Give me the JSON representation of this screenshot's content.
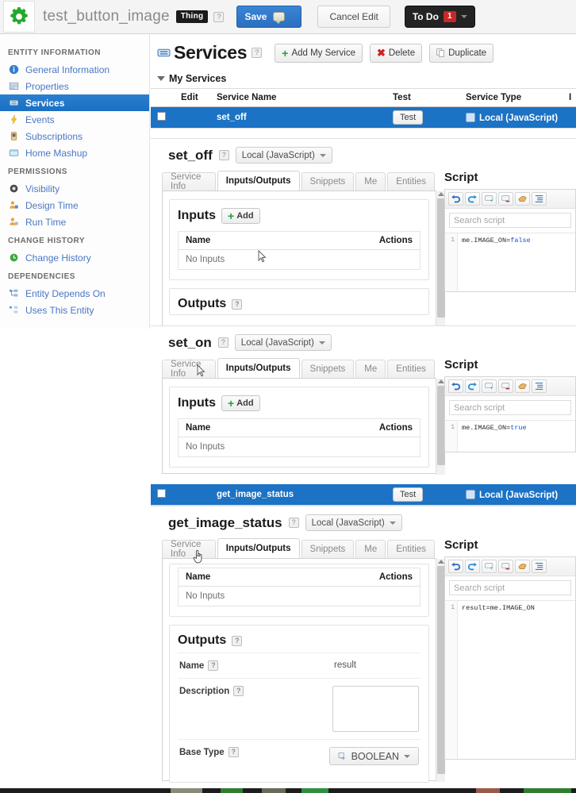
{
  "topbar": {
    "gear_icon": "gear-icon",
    "entity_name": "test_button_image",
    "entity_type_badge": "Thing",
    "help_glyph": "?",
    "save_label": "Save",
    "cancel_label": "Cancel Edit",
    "todo_label": "To Do",
    "todo_count": "1"
  },
  "sidebar": {
    "groups": [
      {
        "title": "ENTITY INFORMATION",
        "items": [
          {
            "label": "General Information",
            "icon": "info-icon",
            "active": false
          },
          {
            "label": "Properties",
            "icon": "properties-icon",
            "active": false
          },
          {
            "label": "Services",
            "icon": "services-icon",
            "active": true
          },
          {
            "label": "Events",
            "icon": "lightning-icon",
            "active": false
          },
          {
            "label": "Subscriptions",
            "icon": "subscriptions-icon",
            "active": false
          },
          {
            "label": "Home Mashup",
            "icon": "mashup-icon",
            "active": false
          }
        ]
      },
      {
        "title": "PERMISSIONS",
        "items": [
          {
            "label": "Visibility",
            "icon": "eye-icon",
            "active": false
          },
          {
            "label": "Design Time",
            "icon": "user-lock-icon",
            "active": false
          },
          {
            "label": "Run Time",
            "icon": "user-lock-icon",
            "active": false
          }
        ]
      },
      {
        "title": "CHANGE HISTORY",
        "items": [
          {
            "label": "Change History",
            "icon": "history-icon",
            "active": false
          }
        ]
      },
      {
        "title": "DEPENDENCIES",
        "items": [
          {
            "label": "Entity Depends On",
            "icon": "depends-on-icon",
            "active": false
          },
          {
            "label": "Uses This Entity",
            "icon": "used-by-icon",
            "active": false
          }
        ]
      }
    ]
  },
  "main": {
    "page_title": "Services",
    "page_title_icon": "services-icon",
    "help_glyph": "?",
    "toolbar": [
      {
        "label": "Add My Service",
        "icon": "plus-icon"
      },
      {
        "label": "Delete",
        "icon": "x-icon"
      },
      {
        "label": "Duplicate",
        "icon": "duplicate-icon"
      }
    ],
    "section_label": "My Services",
    "table": {
      "columns": [
        "",
        "Edit",
        "Service Name",
        "Test",
        "Service Type",
        "I"
      ],
      "rows": [
        {
          "name": "set_off",
          "test_label": "Test",
          "service_type": "Local (JavaScript)",
          "selected": true
        },
        {
          "name": "get_image_status",
          "test_label": "Test",
          "service_type": "Local (JavaScript)",
          "selected": true
        }
      ]
    }
  },
  "panels": [
    {
      "name": "set_off",
      "help_glyph": "?",
      "language": "Local (JavaScript)",
      "tabs": [
        {
          "label": "Service Info",
          "active": false
        },
        {
          "label": "Inputs/Outputs",
          "active": true
        },
        {
          "label": "Snippets",
          "active": false
        },
        {
          "label": "Me",
          "active": false
        },
        {
          "label": "Entities",
          "active": false
        }
      ],
      "inputs": {
        "title": "Inputs",
        "add_label": "Add",
        "col_name": "Name",
        "col_actions": "Actions",
        "empty_text": "No Inputs"
      },
      "outputs": {
        "title": "Outputs",
        "help_glyph": "?"
      },
      "script": {
        "title": "Script",
        "search_placeholder": "Search script",
        "line_number": "1",
        "code_prefix": "me.IMAGE_ON=",
        "code_keyword": "false"
      }
    },
    {
      "name": "set_on",
      "help_glyph": "?",
      "language": "Local (JavaScript)",
      "tabs": [
        {
          "label": "Service Info",
          "active": false
        },
        {
          "label": "Inputs/Outputs",
          "active": true
        },
        {
          "label": "Snippets",
          "active": false
        },
        {
          "label": "Me",
          "active": false
        },
        {
          "label": "Entities",
          "active": false
        }
      ],
      "inputs": {
        "title": "Inputs",
        "add_label": "Add",
        "col_name": "Name",
        "col_actions": "Actions",
        "empty_text": "No Inputs"
      },
      "script": {
        "title": "Script",
        "search_placeholder": "Search script",
        "line_number": "1",
        "code_prefix": "me.IMAGE_ON=",
        "code_keyword": "true"
      }
    },
    {
      "name": "get_image_status",
      "help_glyph": "?",
      "language": "Local (JavaScript)",
      "tabs": [
        {
          "label": "Service Info",
          "active": false
        },
        {
          "label": "Inputs/Outputs",
          "active": true
        },
        {
          "label": "Snippets",
          "active": false
        },
        {
          "label": "Me",
          "active": false
        },
        {
          "label": "Entities",
          "active": false
        }
      ],
      "inputs": {
        "col_name": "Name",
        "col_actions": "Actions",
        "empty_text": "No Inputs"
      },
      "outputs": {
        "title": "Outputs",
        "help_glyph": "?",
        "name_label": "Name",
        "name_value": "result",
        "description_label": "Description",
        "description_value": "",
        "base_type_label": "Base Type",
        "base_type_value": "BOOLEAN"
      },
      "script": {
        "title": "Script",
        "search_placeholder": "Search script",
        "line_number": "1",
        "code_prefix": "result=me.IMAGE_ON",
        "code_keyword": ""
      }
    }
  ],
  "script_toolbar_icons": [
    "undo-icon",
    "redo-icon",
    "add-comment-icon",
    "remove-comment-icon",
    "format-icon",
    "indent-icon"
  ],
  "colors": {
    "accent_blue": "#1c72c4",
    "save_blue": "#2b6fc0",
    "green": "#22a03a",
    "red": "#c62828",
    "link_blue": "#4a77c4"
  }
}
